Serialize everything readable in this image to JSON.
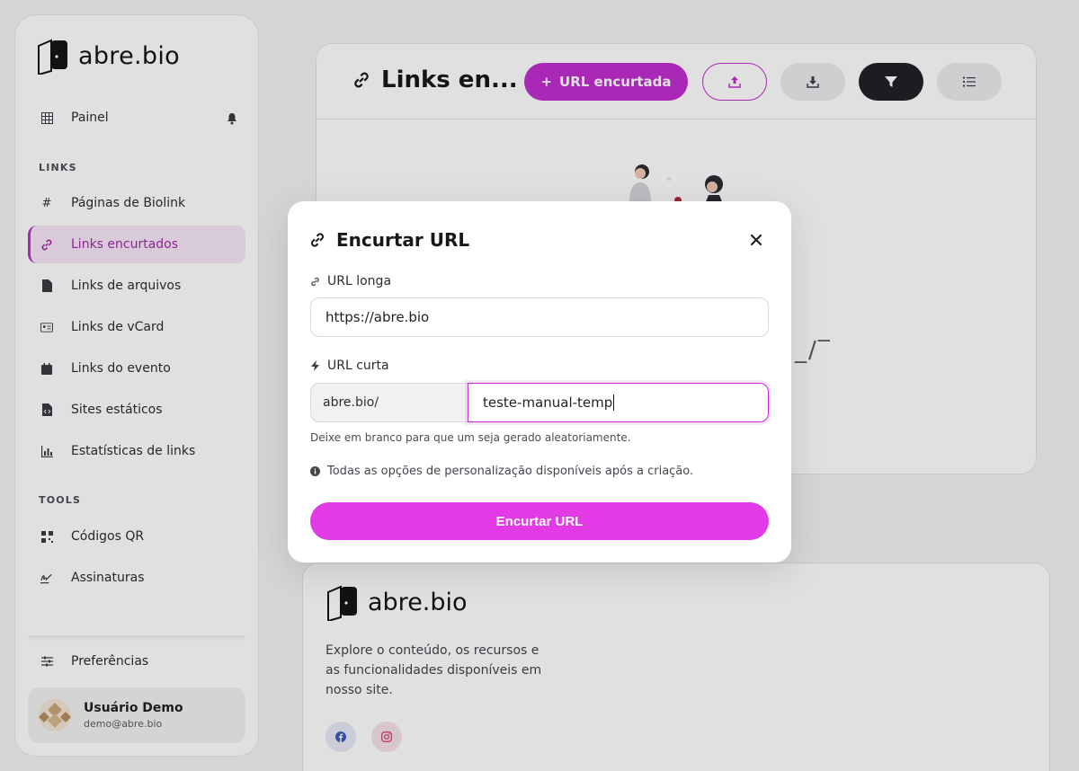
{
  "brand": {
    "name": "abre.bio"
  },
  "sidebar": {
    "top_item": {
      "label": "Painel"
    },
    "sections": [
      {
        "label": "LINKS"
      },
      {
        "label": "TOOLS"
      }
    ],
    "links_items": [
      {
        "label": "Páginas de Biolink",
        "icon": "hash-icon"
      },
      {
        "label": "Links encurtados",
        "icon": "link-icon",
        "active": true
      },
      {
        "label": "Links de arquivos",
        "icon": "file-icon"
      },
      {
        "label": "Links de vCard",
        "icon": "id-card-icon"
      },
      {
        "label": "Links do evento",
        "icon": "calendar-icon"
      },
      {
        "label": "Sites estáticos",
        "icon": "file-code-icon"
      },
      {
        "label": "Estatísticas de links",
        "icon": "chart-icon"
      }
    ],
    "tools_items": [
      {
        "label": "Códigos QR",
        "icon": "qr-icon"
      },
      {
        "label": "Assinaturas",
        "icon": "signature-icon"
      }
    ],
    "preferences": {
      "label": "Preferências"
    },
    "user": {
      "name": "Usuário Demo",
      "email": "demo@abre.bio"
    }
  },
  "main": {
    "title": "Links en...",
    "buttons": {
      "create": "URL encurtada",
      "create_prefix": "+"
    }
  },
  "background_fragment": "_/‾",
  "footer": {
    "description": "Explore o conteúdo, os recursos e as funcionalidades disponíveis em nosso site."
  },
  "modal": {
    "title": "Encurtar URL",
    "long_url": {
      "label": "URL longa",
      "value": "https://abre.bio"
    },
    "short_url": {
      "label": "URL curta",
      "prefix": "abre.bio/",
      "value": "teste-manual-temp",
      "help": "Deixe em branco para que um seja gerado aleatoriamente."
    },
    "info": "Todas as opções de personalização disponíveis após a criação.",
    "submit": "Encurtar URL"
  },
  "colors": {
    "accent": "#c12fd0",
    "submit": "#e23ae5",
    "active_bg": "#f7e6f8",
    "dark_button": "#1f2125"
  }
}
